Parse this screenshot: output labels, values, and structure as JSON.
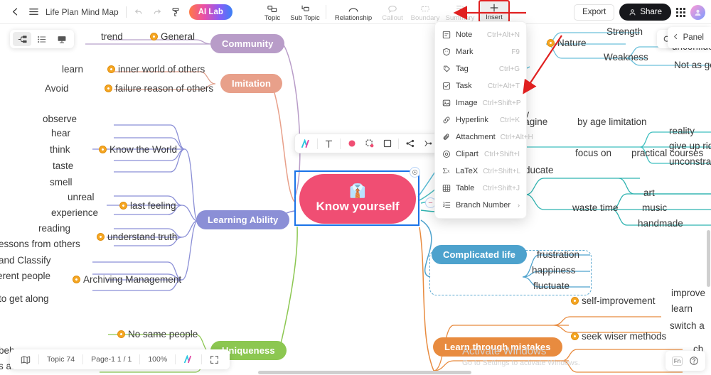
{
  "header": {
    "back_icon": "chevron-left-icon",
    "menu_icon": "hamburger-icon",
    "doc_title": "Life Plan Mind Map",
    "undo_icon": "undo-icon",
    "redo_icon": "redo-icon",
    "format_painter_icon": "format-painter-icon",
    "ai_lab_label": "AI Lab",
    "tools": [
      {
        "label": "Topic",
        "icon": "topic-icon",
        "disabled": false
      },
      {
        "label": "Sub Topic",
        "icon": "subtopic-icon",
        "disabled": false
      },
      {
        "label": "Relationship",
        "icon": "relationship-icon",
        "disabled": false
      },
      {
        "label": "Callout",
        "icon": "callout-icon",
        "disabled": true
      },
      {
        "label": "Boundary",
        "icon": "boundary-icon",
        "disabled": true
      },
      {
        "label": "Summary",
        "icon": "summary-icon",
        "disabled": true
      },
      {
        "label": "Insert",
        "icon": "plus-icon",
        "disabled": false
      }
    ],
    "export_label": "Export",
    "share_label": "Share",
    "apps_icon": "apps-grid-icon",
    "avatar_icon": "user-avatar"
  },
  "insert_menu": {
    "items": [
      {
        "label": "Note",
        "shortcut": "Ctrl+Alt+N",
        "icon": "note-icon"
      },
      {
        "label": "Mark",
        "shortcut": "F9",
        "icon": "mark-icon"
      },
      {
        "label": "Tag",
        "shortcut": "Ctrl+G",
        "icon": "tag-icon"
      },
      {
        "label": "Task",
        "shortcut": "Ctrl+Alt+T",
        "icon": "task-icon"
      },
      {
        "label": "Image",
        "shortcut": "Ctrl+Shift+P",
        "icon": "image-icon"
      },
      {
        "label": "Hyperlink",
        "shortcut": "Ctrl+K",
        "icon": "link-icon"
      },
      {
        "label": "Attachment",
        "shortcut": "Ctrl+Alt+H",
        "icon": "paperclip-icon"
      },
      {
        "label": "Clipart",
        "shortcut": "Ctrl+Shift+I",
        "icon": "clipart-icon"
      },
      {
        "label": "LaTeX",
        "shortcut": "Ctrl+Shift+L",
        "icon": "latex-icon"
      },
      {
        "label": "Table",
        "shortcut": "Ctrl+Shift+J",
        "icon": "table-icon"
      },
      {
        "label": "Branch Number",
        "shortcut": "›",
        "icon": "branch-number-icon"
      }
    ]
  },
  "view_switch": {
    "mindmap_icon": "mindmap-view-icon",
    "outline_icon": "outline-view-icon",
    "presentation_icon": "presentation-view-icon"
  },
  "right_panel": {
    "search_icon": "search-icon",
    "collapse_icon": "chevron-left-icon",
    "panel_label": "Panel"
  },
  "format_toolbar": {
    "buttons": [
      {
        "icon": "style-icon"
      },
      {
        "icon": "text-format-icon"
      },
      {
        "icon": "fill-color-icon",
        "color": "#f04e73"
      },
      {
        "icon": "shape-icon"
      },
      {
        "icon": "border-icon"
      },
      {
        "icon": "branch-style-icon"
      },
      {
        "icon": "layout-icon"
      },
      {
        "icon": "line-style-icon"
      }
    ]
  },
  "mindmap": {
    "center": {
      "label": "Know yourself",
      "emoji": "👔",
      "color": "#f04e73"
    },
    "branches": [
      {
        "label": "Community",
        "color": "#b89cc8"
      },
      {
        "label": "Imitation",
        "color": "#e8a08a"
      },
      {
        "label": "Learning Ability",
        "color": "#8b8fd6"
      },
      {
        "label": "Uniqueness",
        "color": "#8cc751"
      },
      {
        "label": "Complicated life",
        "color": "#4da2cd"
      },
      {
        "label": "Learn through mistakes",
        "color": "#e88b3f"
      }
    ],
    "topics": {
      "trend": "trend",
      "general": "General",
      "learn": "learn",
      "inner_world": "inner world of others",
      "avoid": "Avoid",
      "failure_reason": "failure reason of others",
      "observe": "observe",
      "hear": "hear",
      "think": "think",
      "taste": "taste",
      "smell": "smell",
      "know_the_world": "Know the World",
      "unreal": "unreal",
      "experience": "experience",
      "last_feeling": "last feeling",
      "reading": "reading",
      "lessons_from_others": "essons from others",
      "understand_truth": "understand truth",
      "and_classify": "and Classify",
      "different_people": "erent people",
      "archiving_management": "Archiving Management",
      "to_get_along": "to get along",
      "no_same_people": "No same people",
      "behaviour": "beh",
      "attitude": "s attitude",
      "ss": "ss",
      "nature": "Nature",
      "strength": "Strength",
      "weakness": "Weakness",
      "unconfident": "unconfide",
      "not_as_good": "Not as go",
      "ry": "ry",
      "imagine": "magine",
      "by_age_limitation": "by age limitation",
      "reality": "reality",
      "give_up_ridiculous": "give up rid",
      "unconstrained": "unconstrai",
      "educate": "ducate",
      "focus_on": "focus on",
      "practical_courses": "practical courses",
      "waste_time": "waste time",
      "art": "art",
      "music": "music",
      "handmade": "handmade",
      "frustration": "frustration",
      "happiness": "happiness",
      "fluctuate": "fluctuate",
      "self_improvement": "self-improvement",
      "improve": "improve",
      "learn2": "learn",
      "seek_wiser_methods": "seek wiser methods",
      "switch_a": "switch a",
      "ch": "ch"
    }
  },
  "statusbar": {
    "map_icon": "map-overview-icon",
    "topic_count": "Topic 74",
    "page": "Page-1  1 / 1",
    "zoom": "100%",
    "ai_icon": "ai-icon",
    "fullscreen_icon": "fullscreen-icon"
  },
  "helper": {
    "fn_label": "Fn",
    "help_icon": "question-mark-icon"
  },
  "watermark": {
    "line1": "Activate Windows",
    "line2": "Go to Settings to activate Windows."
  }
}
